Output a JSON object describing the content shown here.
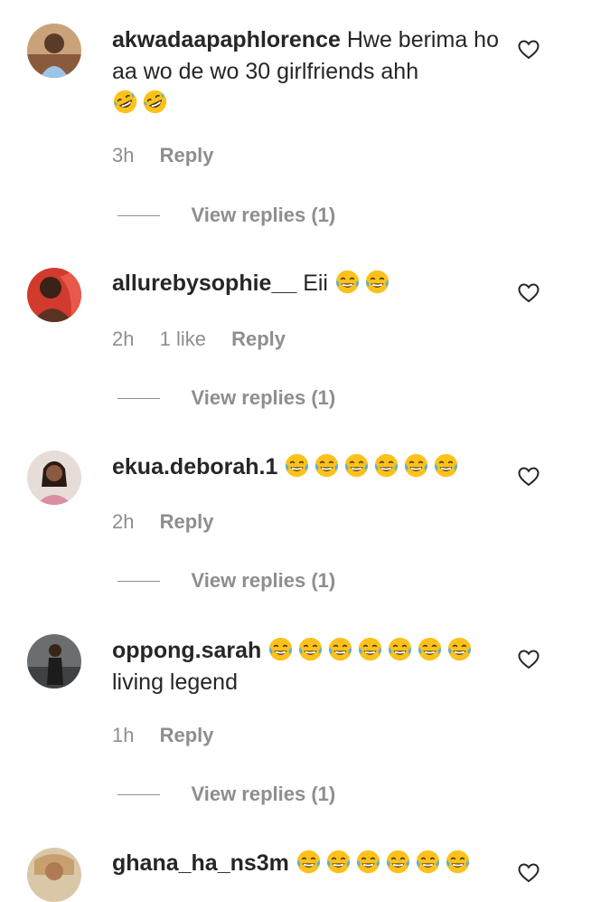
{
  "comments": [
    {
      "username": "akwadaapaphlorence",
      "text": "Hwe berima ho aa wo de wo 30 girlfriends ahh",
      "emojis": [
        "rofl-emoji",
        "rofl-emoji"
      ],
      "time": "3h",
      "likes": "",
      "reply_label": "Reply",
      "view_replies": "View replies (1)"
    },
    {
      "username": "allurebysophie__",
      "text": "Eii",
      "emojis": [
        "joy-emoji",
        "joy-emoji"
      ],
      "time": "2h",
      "likes": "1 like",
      "reply_label": "Reply",
      "view_replies": "View replies (1)"
    },
    {
      "username": "ekua.deborah.1",
      "text": "",
      "emojis": [
        "joy-emoji",
        "joy-emoji",
        "joy-emoji",
        "joy-emoji",
        "joy-emoji",
        "joy-emoji"
      ],
      "time": "2h",
      "likes": "",
      "reply_label": "Reply",
      "view_replies": "View replies (1)"
    },
    {
      "username": "oppong.sarah",
      "text": "living legend",
      "emojis": [
        "joy-emoji",
        "joy-emoji",
        "joy-emoji",
        "joy-emoji",
        "joy-emoji",
        "joy-emoji",
        "joy-emoji"
      ],
      "time": "1h",
      "likes": "",
      "reply_label": "Reply",
      "view_replies": "View replies (1)"
    },
    {
      "username": "ghana_ha_ns3m",
      "text": "",
      "emojis": [
        "joy-emoji",
        "joy-emoji",
        "joy-emoji",
        "joy-emoji",
        "joy-emoji",
        "joy-emoji"
      ],
      "time": "",
      "likes": "",
      "reply_label": "",
      "view_replies": ""
    }
  ],
  "colors": {
    "text": "#262626",
    "meta": "#8e8e8e",
    "emoji_face": "#fcc21b",
    "emoji_tear": "#4fb3e8"
  }
}
